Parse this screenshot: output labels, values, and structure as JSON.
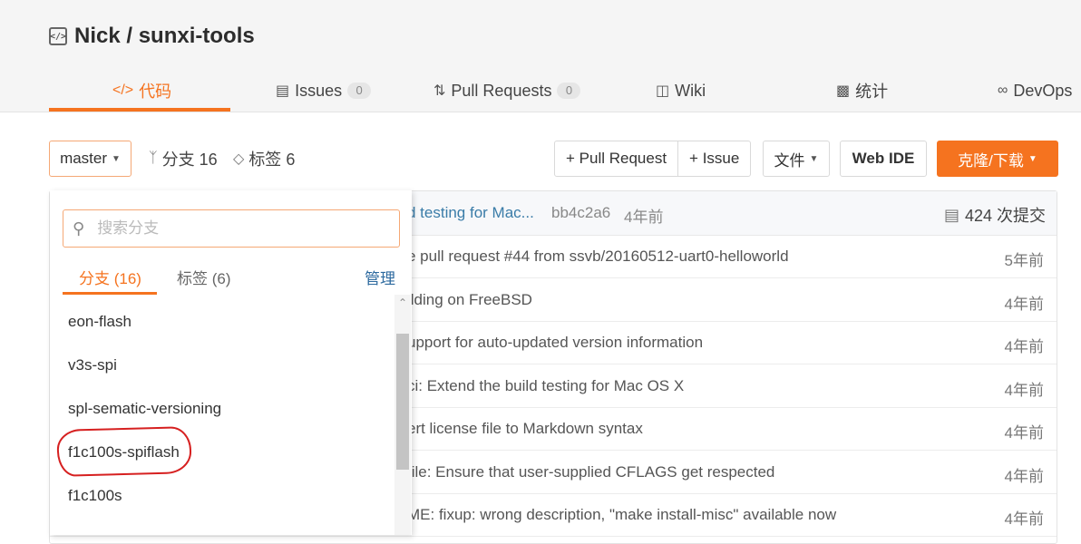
{
  "repo": {
    "title": "Nick / sunxi-tools"
  },
  "nav_tabs": [
    {
      "label": "代码",
      "icon": "code-icon"
    },
    {
      "label": "Issues",
      "icon": "issues-icon",
      "count": "0"
    },
    {
      "label": "Pull Requests",
      "icon": "pull-request-icon",
      "count": "0"
    },
    {
      "label": "Wiki",
      "icon": "wiki-icon"
    },
    {
      "label": "统计",
      "icon": "stats-icon"
    },
    {
      "label": "DevOps",
      "icon": "devops-icon"
    }
  ],
  "toolbar": {
    "branch": "master",
    "branches": "分支 16",
    "tags": "标签 6",
    "pull_request": "+ Pull Request",
    "issue": "+ Issue",
    "file": "文件",
    "web_ide": "Web IDE",
    "clone": "克隆/下载"
  },
  "latest_commit": {
    "message": "d testing for Mac...",
    "hash": "bb4c2a6",
    "age": "4年前",
    "total": "424 次提交"
  },
  "file_rows": [
    {
      "message": "e pull request #44 from ssvb/20160512-uart0-helloworld",
      "time": "5年前"
    },
    {
      "message": "ilding on FreeBSD",
      "time": "4年前"
    },
    {
      "message": "upport for auto-updated version information",
      "time": "4年前"
    },
    {
      "message": "ci: Extend the build testing for Mac OS X",
      "time": "4年前"
    },
    {
      "message": "ert license file to Markdown syntax",
      "time": "4年前"
    },
    {
      "message": "file: Ensure that user-supplied CFLAGS get respected",
      "time": "4年前"
    },
    {
      "message": "ME: fixup: wrong description, \"make install-misc\" available now",
      "time": "4年前"
    }
  ],
  "dropdown": {
    "search_placeholder": "搜索分支",
    "tab_branches": "分支 (16)",
    "tab_tags": "标签 (6)",
    "manage": "管理",
    "branches": [
      "eon-flash",
      "v3s-spi",
      "spl-sematic-versioning",
      "f1c100s-spiflash",
      "f1c100s"
    ],
    "highlighted": "f1c100s-spiflash"
  },
  "colors": {
    "accent": "#f5731f",
    "annotation": "#d62020"
  }
}
